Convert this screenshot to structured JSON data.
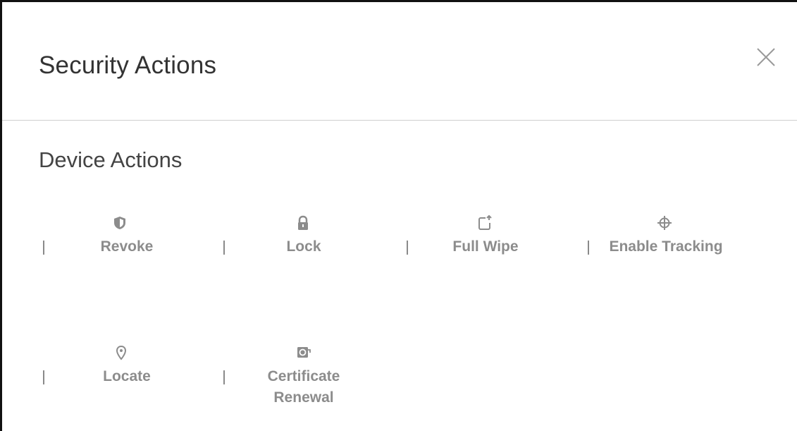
{
  "dialog": {
    "title": "Security Actions",
    "close_icon": "close-icon"
  },
  "section": {
    "title": "Device Actions"
  },
  "actions": [
    {
      "label": "Revoke",
      "icon": "shield-icon"
    },
    {
      "label": "Lock",
      "icon": "lock-icon"
    },
    {
      "label": "Full Wipe",
      "icon": "device-wipe-icon"
    },
    {
      "label": "Enable Tracking",
      "icon": "crosshair-icon"
    },
    {
      "label": "Locate",
      "icon": "location-pin-icon"
    },
    {
      "label_line1": "Certificate",
      "label_line2": "Renewal",
      "icon": "certificate-icon"
    }
  ],
  "colors": {
    "title": "#333333",
    "muted": "#8c8c8c",
    "divider": "#cfcfcf"
  }
}
